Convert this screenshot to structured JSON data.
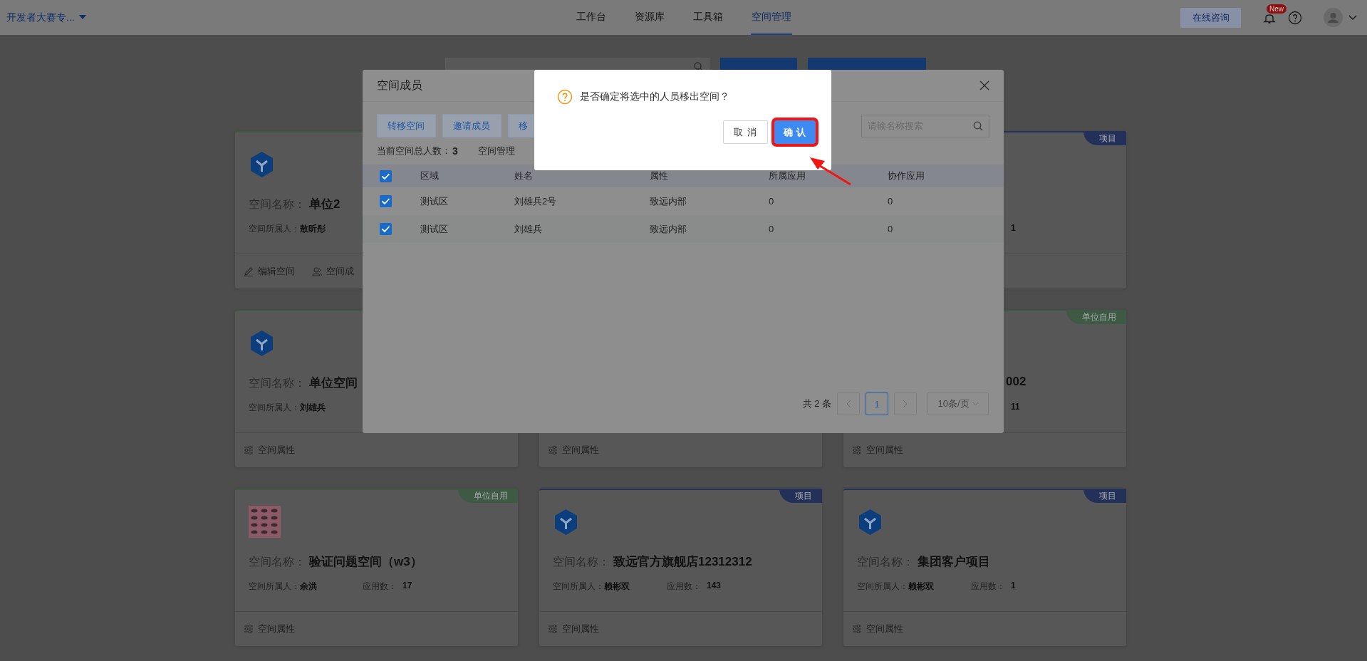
{
  "top_bar": {
    "workspace": "开发者大赛专...",
    "nav": [
      {
        "label": "工作台",
        "selected": false
      },
      {
        "label": "资源库",
        "selected": false
      },
      {
        "label": "工具箱",
        "selected": false
      },
      {
        "label": "空间管理",
        "selected": true
      }
    ],
    "consult_button": "在线咨询",
    "badge": "New"
  },
  "cards": [
    {
      "kind": "unit",
      "name_label": "空间名称：",
      "name": "单位2",
      "owner_label": "空间所属人：",
      "owner": "敖昕彤",
      "footer": [
        {
          "kind": "edit",
          "label": "编辑空间"
        },
        {
          "kind": "members",
          "label": "空间成"
        }
      ]
    },
    {
      "kind": "project",
      "tag": "项目",
      "apps": "1"
    },
    {
      "kind": "unit",
      "name_label": "空间名称：",
      "name": "单位空间",
      "owner_label": "空间所属人：",
      "owner": "刘雄兵",
      "footer": [
        {
          "kind": "props",
          "label": "空间属性"
        }
      ]
    },
    {
      "footer": [
        {
          "kind": "props",
          "label": "空间属性"
        }
      ]
    },
    {
      "kind": "unit",
      "tag": "单位自用",
      "name": "002",
      "apps": "11",
      "footer": [
        {
          "kind": "props",
          "label": "空间属性"
        }
      ]
    },
    {
      "kind": "unit",
      "tag": "单位自用",
      "logo": {
        "kind": "picture"
      },
      "name_label": "空间名称：",
      "name": "验证问题空间（w3）",
      "owner_label": "空间所属人：",
      "owner": "余洪",
      "apps_label": "应用数：",
      "apps": "17",
      "footer": [
        {
          "kind": "props",
          "label": "空间属性"
        }
      ]
    },
    {
      "kind": "project",
      "tag": "项目",
      "name_label": "空间名称：",
      "name": "致远官方旗舰店12312312",
      "owner_label": "空间所属人：",
      "owner": "赖彬双",
      "apps_label": "应用数：",
      "apps": "143",
      "footer": [
        {
          "kind": "props",
          "label": "空间属性"
        }
      ]
    },
    {
      "kind": "project",
      "tag": "项目",
      "name_label": "空间名称：",
      "name": "集团客户项目",
      "owner_label": "空间所属人：",
      "owner": "赖彬双",
      "apps_label": "应用数：",
      "apps": "1",
      "footer": [
        {
          "kind": "props",
          "label": "空间属性"
        }
      ]
    }
  ],
  "members_modal": {
    "title": "空间成员",
    "buttons": [
      "转移空间",
      "邀请成员",
      "移"
    ],
    "search": {
      "placeholder": "请输名称搜索"
    },
    "total_label": "当前空间总人数：",
    "total": "3",
    "admin_label": "空间管理",
    "table": {
      "all_checked": true,
      "columns": [
        "区域",
        "姓名",
        "属性",
        "所属应用",
        "协作应用"
      ],
      "rows": [
        {
          "checked": true,
          "cells": [
            "测试区",
            "刘雄兵2号",
            "致远内部",
            "0",
            "0"
          ]
        },
        {
          "checked": true,
          "cells": [
            "测试区",
            "刘雄兵",
            "致远内部",
            "0",
            "0"
          ]
        }
      ]
    },
    "pagination": {
      "total": "共 2 条",
      "pages": [
        {
          "label": "1",
          "selected": true
        }
      ],
      "page_size": "10条/页"
    }
  },
  "confirm_dialog": {
    "message": "是否确定将选中的人员移出空间？",
    "buttons": [
      {
        "label": "取 消",
        "kind": "secondary",
        "highlighted": false
      },
      {
        "label": "确 认",
        "kind": "primary",
        "highlighted": true
      }
    ]
  }
}
